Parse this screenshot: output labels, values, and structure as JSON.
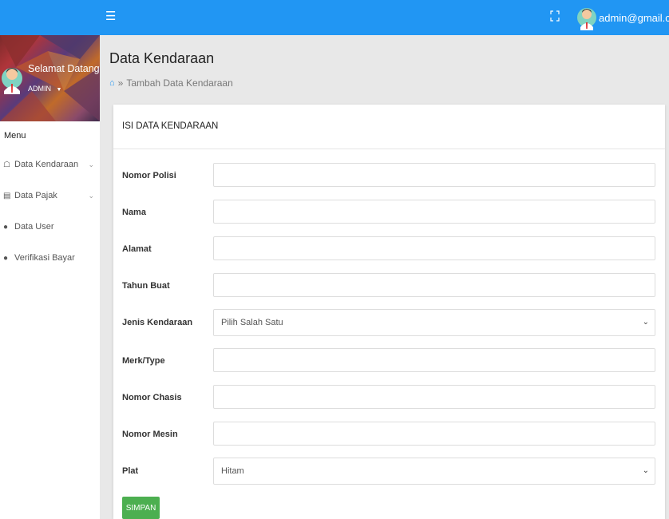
{
  "header": {
    "menu_icon": "hamburger-icon",
    "fullscreen_icon": "fullscreen-icon",
    "user_email": "admin@gmail.com",
    "accent_color": "#2196f3"
  },
  "sidebar": {
    "welcome": "Selamat Datang",
    "role": "ADMIN",
    "menu_heading": "Menu",
    "items": [
      {
        "label": "Data Kendaraan",
        "icon": "car-icon",
        "has_submenu": true
      },
      {
        "label": "Data Pajak",
        "icon": "document-icon",
        "has_submenu": true
      },
      {
        "label": "Data User",
        "icon": "user-icon",
        "has_submenu": false
      },
      {
        "label": "Verifikasi Bayar",
        "icon": "user-icon",
        "has_submenu": false
      }
    ]
  },
  "main": {
    "title": "Data Kendaraan",
    "breadcrumb": "Tambah Data Kendaraan",
    "card_title": "ISI DATA KENDARAAN",
    "fields": {
      "nomor_polisi": "Nomor Polisi",
      "nama": "Nama",
      "alamat": "Alamat",
      "tahun_buat": "Tahun Buat",
      "jenis_kendaraan": "Jenis Kendaraan",
      "merk_type": "Merk/Type",
      "nomor_chasis": "Nomor Chasis",
      "nomor_mesin": "Nomor Mesin",
      "plat": "Plat"
    },
    "jenis_kendaraan_selected": "Pilih Salah Satu",
    "plat_selected": "Hitam",
    "submit_label": "SIMPAN",
    "submit_color": "#4caf50"
  }
}
